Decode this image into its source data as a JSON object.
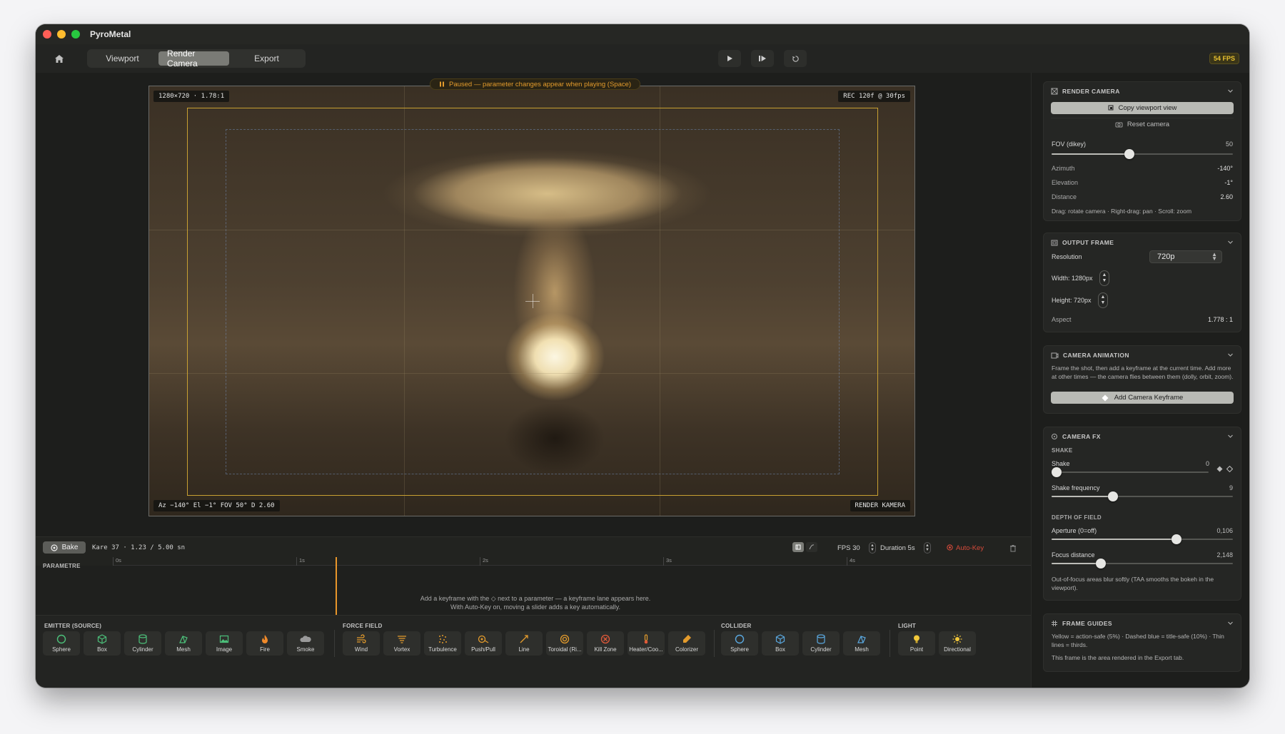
{
  "app": {
    "title": "PyroMetal"
  },
  "toolbar": {
    "tabs": [
      {
        "label": "Viewport",
        "active": false
      },
      {
        "label": "Render Camera",
        "active": true
      },
      {
        "label": "Export",
        "active": false
      }
    ],
    "fps_badge": "54 FPS"
  },
  "viewport": {
    "pause_banner": "Paused — parameter changes appear when playing (Space)",
    "resolution_label": "1280×720  ·  1.78:1",
    "rec_label": "REC 120f @ 30fps",
    "camera_label": "Az −140°  El −1°  FOV 50°  D 2.60",
    "mode_label": "RENDER KAMERA"
  },
  "timeline": {
    "bake_label": "Bake",
    "frame_info": "Kare 37 · 1.23 / 5.00 sn",
    "fps_label": "FPS 30",
    "duration_label": "Duration 5s",
    "autokey_label": "Auto-Key",
    "param_header": "PARAMETRE",
    "ticks": [
      "0s",
      "1s",
      "2s",
      "3s",
      "4s"
    ],
    "hint_line1": "Add a keyframe with the ◇ next to a parameter — a keyframe lane appears here.",
    "hint_line2": "With Auto-Key on, moving a slider adds a key automatically."
  },
  "palette": {
    "emitter_label": "EMITTER (SOURCE)",
    "emitter": [
      "Sphere",
      "Box",
      "Cylinder",
      "Mesh",
      "Image",
      "Fire",
      "Smoke"
    ],
    "force_label": "FORCE FIELD",
    "force": [
      "Wind",
      "Vortex",
      "Turbulence",
      "Push/Pull",
      "Line",
      "Toroidal (Ri...",
      "Kill Zone",
      "Heater/Coo...",
      "Colorizer"
    ],
    "collider_label": "COLLIDER",
    "collider": [
      "Sphere",
      "Box",
      "Cylinder",
      "Mesh"
    ],
    "light_label": "LIGHT",
    "light": [
      "Point",
      "Directional"
    ]
  },
  "render_camera": {
    "header": "RENDER CAMERA",
    "copy_btn": "Copy viewport view",
    "reset_btn": "Reset camera",
    "fov_label": "FOV (dikey)",
    "fov_value": "50",
    "fov_fraction": 0.43,
    "azimuth_label": "Azimuth",
    "azimuth_value": "-140°",
    "elevation_label": "Elevation",
    "elevation_value": "-1°",
    "distance_label": "Distance",
    "distance_value": "2.60",
    "help": "Drag: rotate camera · Right-drag: pan · Scroll: zoom"
  },
  "output_frame": {
    "header": "OUTPUT FRAME",
    "resolution_label": "Resolution",
    "resolution_value": "720p",
    "width_label": "Width: 1280px",
    "height_label": "Height: 720px",
    "aspect_label": "Aspect",
    "aspect_value": "1.778 : 1"
  },
  "camera_animation": {
    "header": "CAMERA ANIMATION",
    "desc": "Frame the shot, then add a keyframe at the current time. Add more at other times — the camera flies between them (dolly, orbit, zoom).",
    "add_btn": "Add Camera Keyframe"
  },
  "camera_fx": {
    "header": "CAMERA FX",
    "shake_section": "SHAKE",
    "shake_label": "Shake",
    "shake_value": "0",
    "shake_fraction": 0.0,
    "shake_freq_label": "Shake frequency",
    "shake_freq_value": "9",
    "shake_freq_fraction": 0.34,
    "dof_section": "DEPTH OF FIELD",
    "aperture_label": "Aperture (0=off)",
    "aperture_value": "0,106",
    "aperture_fraction": 0.69,
    "focus_label": "Focus distance",
    "focus_value": "2,148",
    "focus_fraction": 0.27,
    "dof_help": "Out-of-focus areas blur softly (TAA smooths the bokeh in the viewport)."
  },
  "frame_guides": {
    "header": "FRAME GUIDES",
    "line1": "Yellow = action-safe (5%) · Dashed blue = title-safe (10%) · Thin lines = thirds.",
    "line2": "This frame is the area rendered in the Export tab."
  },
  "colors": {
    "accent": "#e9962a",
    "safe_yellow": "#c8a032",
    "autokey_red": "#d44a3a"
  }
}
